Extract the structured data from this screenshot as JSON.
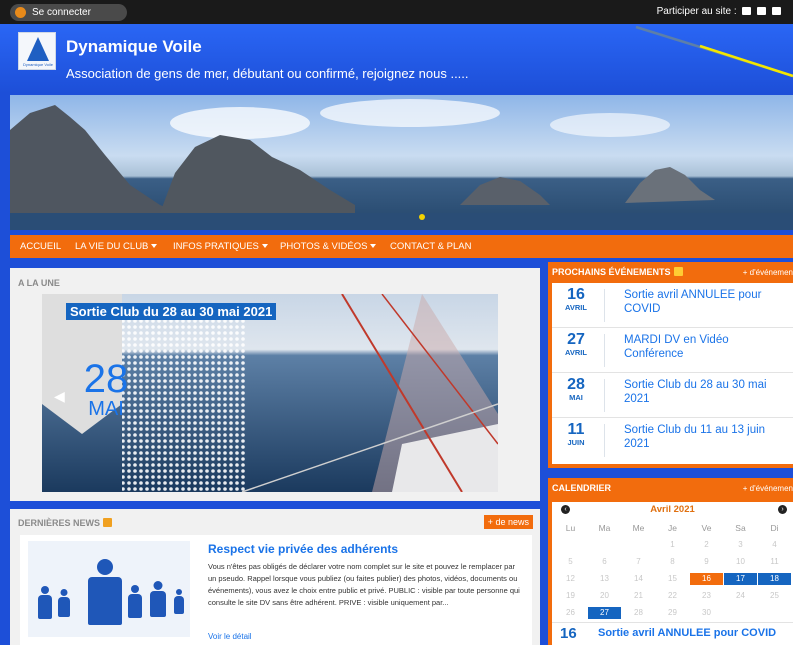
{
  "topbar": {
    "login_label": "Se connecter",
    "participate_label": "Participer au site :"
  },
  "header": {
    "logo_text": "Dynamique Voile",
    "title": "Dynamique Voile",
    "tagline": "Association de gens de mer, débutant ou confirmé, rejoignez nous ....."
  },
  "nav": {
    "items": [
      {
        "label": "ACCUEIL"
      },
      {
        "label": "LA VIE DU CLUB"
      },
      {
        "label": "INFOS PRATIQUES"
      },
      {
        "label": "PHOTOS & VIDÉOS"
      },
      {
        "label": "CONTACT & PLAN"
      }
    ]
  },
  "une": {
    "title": "A LA UNE",
    "caption": "Sortie Club du 28 au 30 mai 2021",
    "day": "28",
    "month": "MAI"
  },
  "news": {
    "title": "DERNIÈRES NEWS",
    "more_label": "+ de news",
    "article_title": "Respect vie privée des adhérents",
    "article_body": "Vous n'êtes pas obligés de déclarer votre nom complet sur le site et pouvez le remplacer par un pseudo. Rappel lorsque vous publiez (ou faites publier) des photos, vidéos, documents ou événements), vous avez le choix entre public et privé. PUBLIC : visible par toute personne qui consulte le site DV sans être adhérent. PRIVE : visible uniquement par...",
    "read_more": "Voir le détail"
  },
  "events": {
    "title": "PROCHAINS ÉVÉNEMENTS",
    "more_label": "+ d'événemen",
    "items": [
      {
        "day": "16",
        "month": "AVRIL",
        "title": "Sortie avril ANNULEE pour COVID"
      },
      {
        "day": "27",
        "month": "AVRIL",
        "title": "MARDI DV en Vidéo Conférence"
      },
      {
        "day": "28",
        "month": "MAI",
        "title": "Sortie Club du 28 au 30 mai 2021"
      },
      {
        "day": "11",
        "month": "JUIN",
        "title": "Sortie Club du 11 au 13 juin 2021"
      }
    ]
  },
  "calendar": {
    "title": "CALENDRIER",
    "more_label": "+ d'événemen",
    "month_label": "Avril 2021",
    "prev_symbol": "‹",
    "next_symbol": "›",
    "weekdays": [
      "Lu",
      "Ma",
      "Me",
      "Je",
      "Ve",
      "Sa",
      "Di"
    ],
    "weeks": [
      [
        "",
        "",
        "",
        "1",
        "2",
        "3",
        "4"
      ],
      [
        "5",
        "6",
        "7",
        "8",
        "9",
        "10",
        "11"
      ],
      [
        "12",
        "13",
        "14",
        "15",
        "16",
        "17",
        "18"
      ],
      [
        "19",
        "20",
        "21",
        "22",
        "23",
        "24",
        "25"
      ],
      [
        "26",
        "27",
        "28",
        "29",
        "30",
        "",
        ""
      ]
    ],
    "highlight_orange": [
      "16"
    ],
    "highlight_blue": [
      "17",
      "18"
    ],
    "today": "27",
    "selected_event_day": "16",
    "selected_event_title": "Sortie avril ANNULEE pour COVID"
  },
  "colors": {
    "background": "#1d4fd8",
    "accent_orange": "#f26c0d",
    "link_blue": "#1a73e8",
    "date_blue": "#1565c0"
  }
}
